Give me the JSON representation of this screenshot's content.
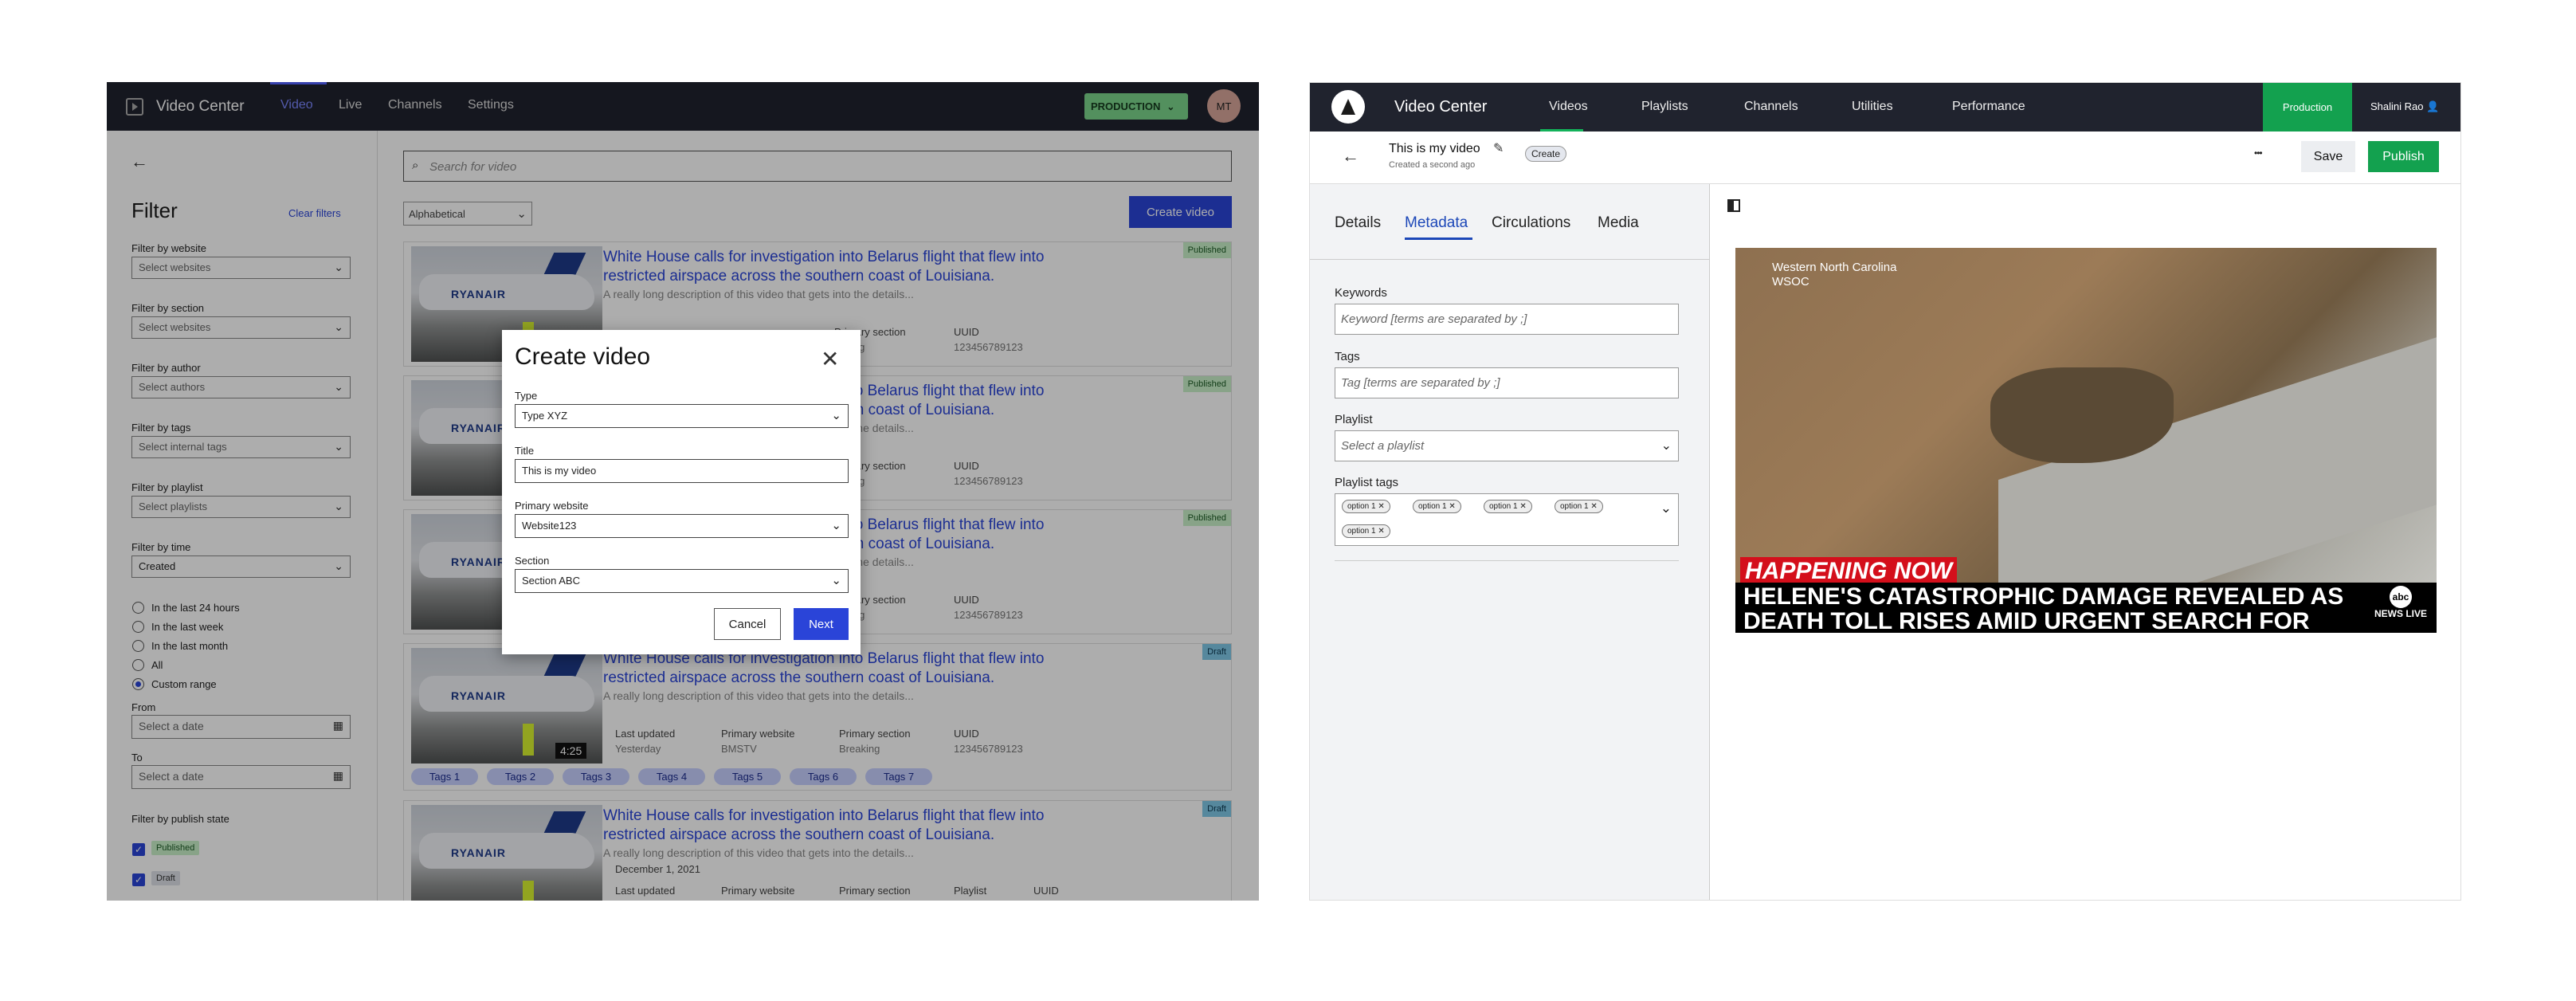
{
  "left": {
    "app_title": "Video Center",
    "nav": [
      "Video",
      "Live",
      "Channels",
      "Settings"
    ],
    "env": "PRODUCTION",
    "avatar": "MT",
    "filter": {
      "title": "Filter",
      "clear": "Clear filters",
      "website_label": "Filter by website",
      "website_value": "Select websites",
      "section_label": "Filter by section",
      "section_value": "Select websites",
      "author_label": "Filter by author",
      "author_value": "Select authors",
      "tags_label": "Filter by tags",
      "tags_value": "Select internal tags",
      "playlist_label": "Filter by playlist",
      "playlist_value": "Select playlists",
      "time_label": "Filter by time",
      "time_value": "Created",
      "time_options": [
        "In the last 24 hours",
        "In the last week",
        "In the last month",
        "All",
        "Custom range"
      ],
      "from_label": "From",
      "from_placeholder": "Select a date",
      "to_label": "To",
      "to_placeholder": "Select a date",
      "publish_label": "Filter by publish state",
      "publish_states": [
        "Published",
        "Draft"
      ]
    },
    "search_placeholder": "Search for video",
    "sort": "Alphabetical",
    "create_button": "Create video",
    "video_title": "White House calls for investigation into Belarus flight that flew into restricted airspace across the southern coast of Louisiana.",
    "video_desc": "A really long description of this video that gets into the details...",
    "meta": {
      "last_updated": "Last updated",
      "primary_website": "Primary website",
      "primary_section": "Primary section",
      "uuid": "UUID",
      "playlist": "Playlist",
      "updated_value": "Yesterday",
      "website_value": "BMSTV",
      "section_value": "Breaking",
      "section_value_partial": "eaking",
      "uuid_value": "123456789123",
      "duration": "4:25",
      "date": "December 1, 2021"
    },
    "states": [
      "Published",
      "Published",
      "Published",
      "Draft",
      "Draft"
    ],
    "tags": [
      "Tags 1",
      "Tags 2",
      "Tags 3",
      "Tags 4",
      "Tags 5",
      "Tags 6",
      "Tags 7"
    ],
    "modal": {
      "title": "Create video",
      "type_label": "Type",
      "type_value": "Type XYZ",
      "title_label": "Title",
      "title_value": "This is my video",
      "website_label": "Primary website",
      "website_value": "Website123",
      "section_label": "Section",
      "section_value": "Section ABC",
      "cancel": "Cancel",
      "next": "Next"
    }
  },
  "right": {
    "app_title": "Video Center",
    "nav": [
      "Videos",
      "Playlists",
      "Channels",
      "Utilities",
      "Performance"
    ],
    "env": "Production",
    "user": "Shalini Rao",
    "video_title": "This is my video",
    "created": "Created a second ago",
    "status_badge": "Create",
    "more": "•••",
    "save": "Save",
    "publish": "Publish",
    "tabs": [
      "Details",
      "Metadata",
      "Circulations",
      "Media"
    ],
    "keywords_label": "Keywords",
    "keywords_placeholder": "Keyword [terms are separated by ;]",
    "tags_label": "Tags",
    "tags_placeholder": "Tag [terms are separated by ;]",
    "playlist_label": "Playlist",
    "playlist_placeholder": "Select a playlist",
    "playlist_tags_label": "Playlist tags",
    "chips": [
      "option 1",
      "option 1",
      "option 1",
      "option 1",
      "option 1"
    ],
    "video": {
      "location": "Western North Carolina",
      "station": "WSOC",
      "banner": "HAPPENING NOW",
      "headline": "HELENE'S CATASTROPHIC DAMAGE REVEALED AS DEATH TOLL RISES AMID URGENT SEARCH FOR MISSING PEOPLE",
      "logo": "abc",
      "logo_sub": "NEWS LIVE"
    }
  }
}
